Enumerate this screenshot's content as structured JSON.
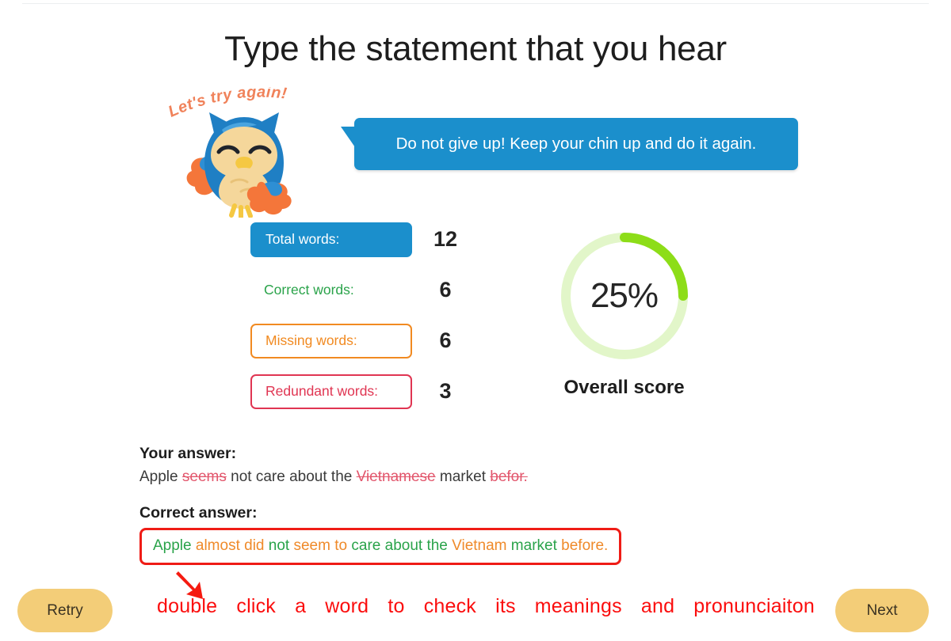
{
  "page": {
    "title": "Type the statement that you hear"
  },
  "mascot": {
    "caption": "Let's try again!",
    "icon": "owl-mascot",
    "colors": {
      "caption": "#f0825a",
      "body": "#1f7fc4",
      "belly": "#f5d79b",
      "accent": "#f4763a"
    }
  },
  "feedback": {
    "message": "Do not give up! Keep your chin up and do it again.",
    "bubble_color": "#1b8fcc"
  },
  "stats": {
    "rows": [
      {
        "label": "Total words:",
        "value": "12",
        "style": "total",
        "color": "#1b8fcc"
      },
      {
        "label": "Correct words:",
        "value": "6",
        "style": "correct",
        "color": "#2aa34a"
      },
      {
        "label": "Missing words:",
        "value": "6",
        "style": "missing",
        "color": "#f18a21"
      },
      {
        "label": "Redundant words:",
        "value": "3",
        "style": "redundant",
        "color": "#e03552"
      }
    ]
  },
  "score": {
    "percent_label": "25%",
    "percent_value": 25,
    "caption": "Overall score",
    "arc_color": "#8ddd18",
    "track_color": "#e2f6c9"
  },
  "answers": {
    "your_answer_heading": "Your answer:",
    "your_answer_words": [
      {
        "text": "Apple",
        "state": "ok"
      },
      {
        "text": "seems",
        "state": "wrong"
      },
      {
        "text": "not",
        "state": "ok"
      },
      {
        "text": "care",
        "state": "ok"
      },
      {
        "text": "about",
        "state": "ok"
      },
      {
        "text": "the",
        "state": "ok"
      },
      {
        "text": "Vietnamese",
        "state": "wrong"
      },
      {
        "text": "market",
        "state": "ok"
      },
      {
        "text": "befor.",
        "state": "wrong"
      }
    ],
    "correct_answer_heading": "Correct answer:",
    "correct_answer_words": [
      {
        "text": "Apple",
        "state": "matched"
      },
      {
        "text": "almost",
        "state": "missing"
      },
      {
        "text": "did",
        "state": "missing"
      },
      {
        "text": "not",
        "state": "matched"
      },
      {
        "text": "seem",
        "state": "missing"
      },
      {
        "text": "to",
        "state": "missing"
      },
      {
        "text": "care",
        "state": "matched"
      },
      {
        "text": "about",
        "state": "matched"
      },
      {
        "text": "the",
        "state": "matched"
      },
      {
        "text": "Vietnam",
        "state": "missing"
      },
      {
        "text": "market",
        "state": "matched"
      },
      {
        "text": "before.",
        "state": "missing"
      }
    ],
    "box_border_color": "#ef1c16"
  },
  "hint": {
    "text": "double click a word to check its meanings and pronunciaiton",
    "color": "#fb0d0d",
    "arrow_icon": "down-right-arrow-icon"
  },
  "footer": {
    "retry_label": "Retry",
    "next_label": "Next",
    "button_color": "#f3cd78"
  }
}
